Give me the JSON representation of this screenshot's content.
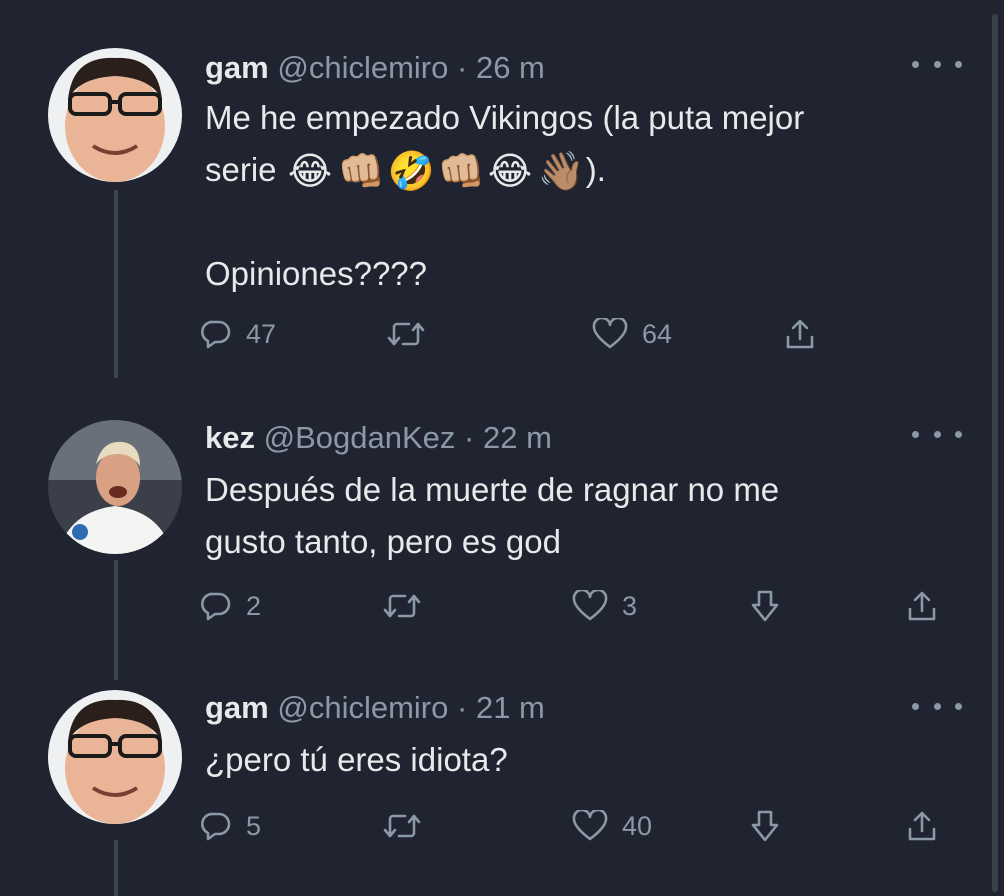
{
  "colors": {
    "background": "#1f2430",
    "text_primary": "#e7e9ea",
    "text_secondary": "#8b98a5",
    "thread_line": "#3d4350"
  },
  "tweets": [
    {
      "name": "gam",
      "handle": "@chiclemiro",
      "sep": "·",
      "time": "26 m",
      "line1": "Me he empezado Vikingos (la puta mejor",
      "line2_prefix": "serie",
      "emojis": [
        "😂",
        "👊🏼",
        "🤣",
        "👊🏼",
        "😂",
        "👋🏽"
      ],
      "line2_suffix": ").",
      "line3": "Opiniones????",
      "replies": "47",
      "likes": "64"
    },
    {
      "name": "kez",
      "handle": "@BogdanKez",
      "sep": "·",
      "time": "22 m",
      "line1": "Después de la muerte de ragnar no me",
      "line2": "gusto tanto, pero es god",
      "replies": "2",
      "likes": "3"
    },
    {
      "name": "gam",
      "handle": "@chiclemiro",
      "sep": "·",
      "time": "21 m",
      "line1": "¿pero tú eres idiota?",
      "replies": "5",
      "likes": "40"
    }
  ],
  "icons": {
    "reply": "reply-icon",
    "retweet": "retweet-icon",
    "like": "heart-icon",
    "downvote": "downvote-icon",
    "share": "share-icon",
    "more": "more-icon"
  }
}
